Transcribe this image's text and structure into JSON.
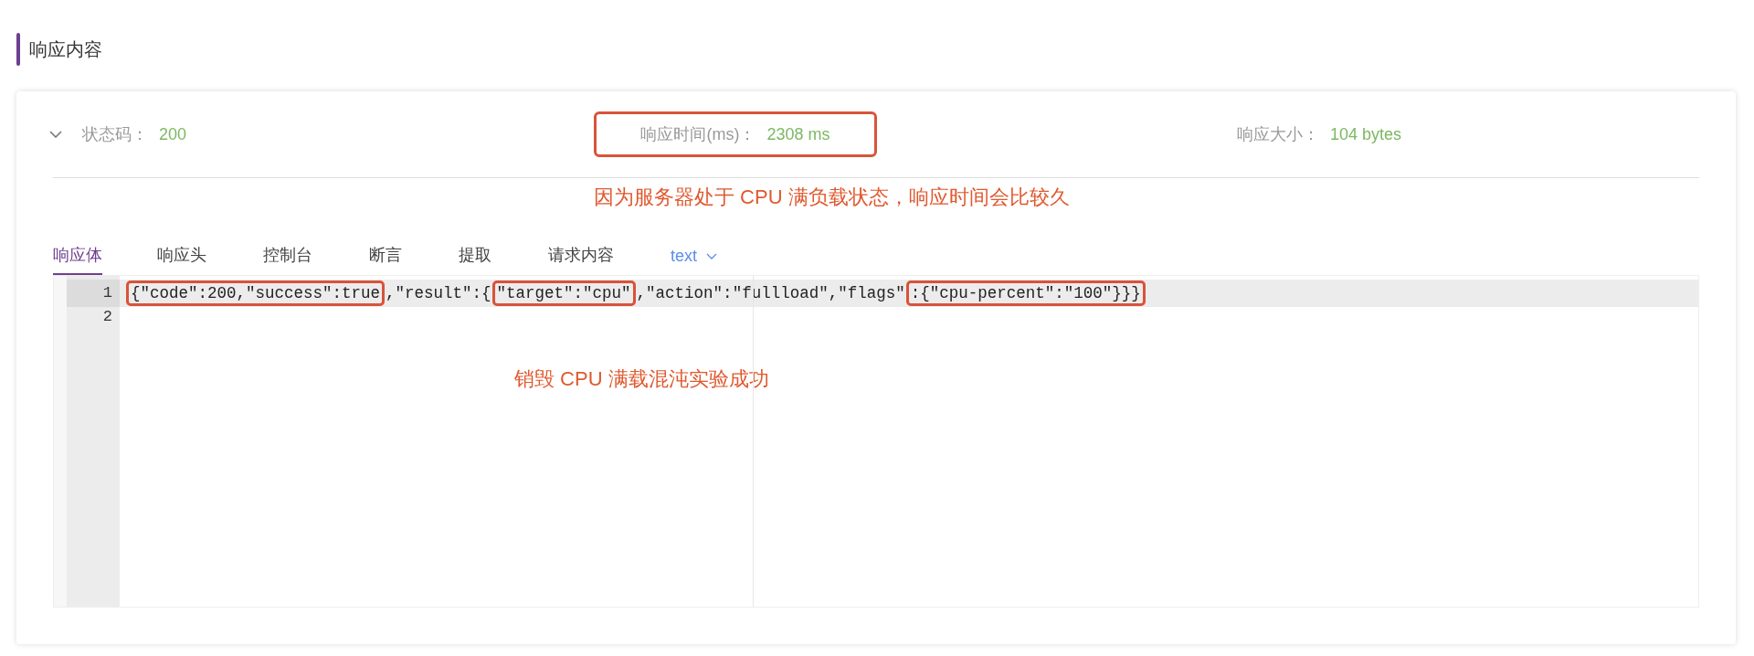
{
  "section_title": "响应内容",
  "metrics": [
    {
      "label": "状态码：",
      "value": "200",
      "boxed": false
    },
    {
      "label": "响应时间(ms)：",
      "value": "2308 ms",
      "boxed": true
    },
    {
      "label": "响应大小：",
      "value": "104 bytes",
      "boxed": false
    }
  ],
  "note_top": "因为服务器处于 CPU 满负载状态，响应时间会比较久",
  "tabs": [
    {
      "label": "响应体",
      "selected": true,
      "kind": "tab"
    },
    {
      "label": "响应头",
      "selected": false,
      "kind": "tab"
    },
    {
      "label": "控制台",
      "selected": false,
      "kind": "tab"
    },
    {
      "label": "断言",
      "selected": false,
      "kind": "tab"
    },
    {
      "label": "提取",
      "selected": false,
      "kind": "tab"
    },
    {
      "label": "请求内容",
      "selected": false,
      "kind": "tab"
    },
    {
      "label": "text",
      "selected": false,
      "kind": "dropdown"
    }
  ],
  "editor": {
    "lines": [
      {
        "number": "1",
        "segments": [
          {
            "text": "{\"code\":200,\"success\":true",
            "boxed": true
          },
          {
            "text": ",\"result\":{",
            "boxed": false
          },
          {
            "text": "\"target\":\"cpu\"",
            "boxed": true
          },
          {
            "text": ",\"action\":\"fullload\",\"flags\"",
            "boxed": false
          },
          {
            "text": ":{\"cpu-percent\":\"100\"}}}",
            "boxed": true
          }
        ]
      },
      {
        "number": "2"
      }
    ]
  },
  "note_code": "销毁 CPU 满载混沌实验成功"
}
